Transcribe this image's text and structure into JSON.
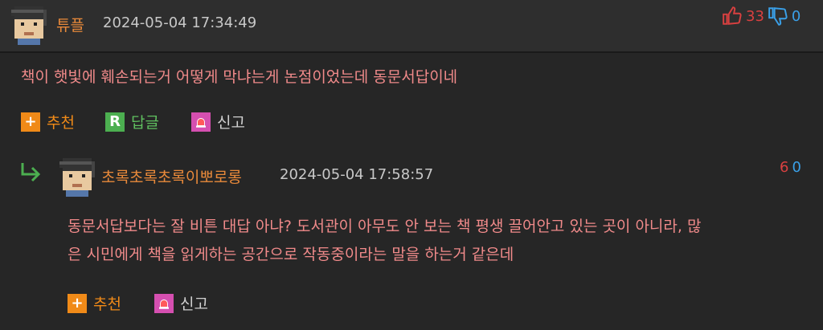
{
  "comment": {
    "author": "튜플",
    "timestamp": "2024-05-04 17:34:49",
    "body": "책이 햇빛에 훼손되는거 어떻게 막냐는게 논점이었는데 동문서답이네",
    "upvotes": "33",
    "downvotes": "0",
    "actions": {
      "recommend": "추천",
      "reply": "답글",
      "report": "신고"
    },
    "reply_icon_letter": "R"
  },
  "reply": {
    "author": "초록초록초록이뽀로롱",
    "timestamp": "2024-05-04 17:58:57",
    "body_line1": "동문서답보다는 잘 비튼 대답 아냐? 도서관이 아무도 안 보는 책 평생 끌어안고 있는 곳이 아니라, 많",
    "body_line2": "은 시민에게 책을 읽게하는 공간으로 작동중이라는 말을 하는거 같은데",
    "upvotes": "6",
    "downvotes": "0",
    "actions": {
      "recommend": "추천",
      "report": "신고"
    }
  },
  "colors": {
    "background": "#262626",
    "nickname": "#e8893a",
    "body_text": "#f08a8a",
    "upvote": "#d94040",
    "downvote": "#3aa0e8"
  },
  "icons": [
    "avatar-pixel-icon",
    "thumbs-up-icon",
    "thumbs-down-icon",
    "plus-icon",
    "reply-r-icon",
    "report-siren-icon",
    "reply-arrow-icon"
  ]
}
